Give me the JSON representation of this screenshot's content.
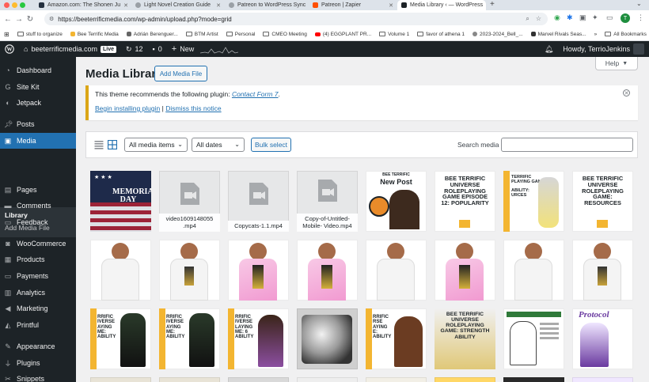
{
  "browser": {
    "tabs": [
      {
        "title": "Amazon.com: The Shonen Ju",
        "fav_color": "#232f3e"
      },
      {
        "title": "Light Novel Creation Guide",
        "fav_color": "#888888"
      },
      {
        "title": "Patreon to WordPress Sync",
        "fav_color": "#888888"
      },
      {
        "title": "Patreon | Zapier",
        "fav_color": "#ff4f00"
      },
      {
        "title": "Media Library ‹ — WordPress",
        "fav_color": "#1d2327"
      }
    ],
    "url": "https://beeterrificmedia.com/wp-admin/upload.php?mode=grid",
    "bookmarks": [
      "stuff to organize",
      "Bee Terrific Media",
      "Adrián Berenguer...",
      "BTM Artist",
      "Personal",
      "CMEO Meeting",
      "(4) EGGPLANT PR...",
      "Volume 1",
      "favor of athena 1",
      "2023-2024_Bell_...",
      "Marvel Rivals Seas..."
    ],
    "all_bookmarks": "All Bookmarks",
    "profile_letter": "T"
  },
  "adminbar": {
    "site_name": "beeterrificmedia.com",
    "live": "Live",
    "updates": "12",
    "comments": "0",
    "new": "New",
    "howdy": "Howdy, TerrioJenkins"
  },
  "sidebar": {
    "items": [
      {
        "label": "Dashboard",
        "icon": "gauge-icon"
      },
      {
        "label": "Site Kit",
        "icon": "sitekit-icon"
      },
      {
        "label": "Jetpack",
        "icon": "jetpack-icon"
      },
      {
        "label": "Posts",
        "icon": "pin-icon"
      },
      {
        "label": "Media",
        "icon": "media-icon"
      },
      {
        "label": "Pages",
        "icon": "page-icon"
      },
      {
        "label": "Comments",
        "icon": "comment-icon"
      },
      {
        "label": "Feedback",
        "icon": "feedback-icon"
      },
      {
        "label": "WooCommerce",
        "icon": "woo-icon"
      },
      {
        "label": "Products",
        "icon": "product-icon"
      },
      {
        "label": "Payments",
        "icon": "payments-icon"
      },
      {
        "label": "Analytics",
        "icon": "analytics-icon"
      },
      {
        "label": "Marketing",
        "icon": "megaphone-icon"
      },
      {
        "label": "Printful",
        "icon": "printful-icon"
      },
      {
        "label": "Appearance",
        "icon": "brush-icon"
      },
      {
        "label": "Plugins",
        "icon": "plugin-icon"
      },
      {
        "label": "Snippets",
        "icon": "snippet-icon"
      }
    ],
    "submenu": {
      "library": "Library",
      "add_media_file": "Add Media File"
    }
  },
  "main": {
    "title": "Media Library",
    "add_media_button": "Add Media File",
    "help": "Help",
    "notice": {
      "text": "This theme recommends the following plugin:",
      "plugin": "Contact Form 7",
      "begin": "Begin installing plugin",
      "separator": "|",
      "dismiss": "Dismiss this notice"
    },
    "filters": {
      "type": "All media items",
      "date": "All dates",
      "bulk": "Bulk select",
      "search_label": "Search media"
    },
    "tiles": {
      "memorial": {
        "line1": "MEMORIAL",
        "line2": "DAY"
      },
      "video1": "video1609148055 .mp4",
      "video2": "Copycats-1.1.mp4",
      "video3": "Copy-of-Untitled- Mobile- Video.mp4",
      "newpost": {
        "brand": "BEE TERRIFIC",
        "title": "New Post"
      },
      "ep12": {
        "title": "BEE TERRIFIC UNIVERSE ROLEPLAYING GAME EPISODE 12: POPULARITY"
      },
      "game_fragment": {
        "l1": "TERRIFIC",
        "l2": "PLAYING GAME",
        "l3": "ABILITY:",
        "l4": "URCES"
      },
      "resources": {
        "title": "BEE TERRIFIC UNIVERSE ROLEPLAYING GAME: RESOURCES"
      },
      "row3_frag1": {
        "t": "RRIFIC IVERSE AYING ME: ABILITY"
      },
      "row3_frag2": {
        "t": "RRIFIC IVERSE AYING ME: ABILITY"
      },
      "row3_frag3": {
        "t": "RRIFIC IVERSE LAYING ME: 6 ABILITY"
      },
      "row3_frag6": {
        "t": "RRIFIC RSE AYING E: ABILITY"
      },
      "strength": {
        "title": "BEE TERRIFIC UNIVERSE ROLEPLAYING GAME: STRENGTH ABILITY"
      },
      "protocol": {
        "title": "Protocol"
      }
    }
  },
  "colors": {
    "accent": "#2271b1",
    "admin_dark": "#1d2327",
    "notice_border": "#dba617",
    "brand_yellow": "#f3b531"
  }
}
